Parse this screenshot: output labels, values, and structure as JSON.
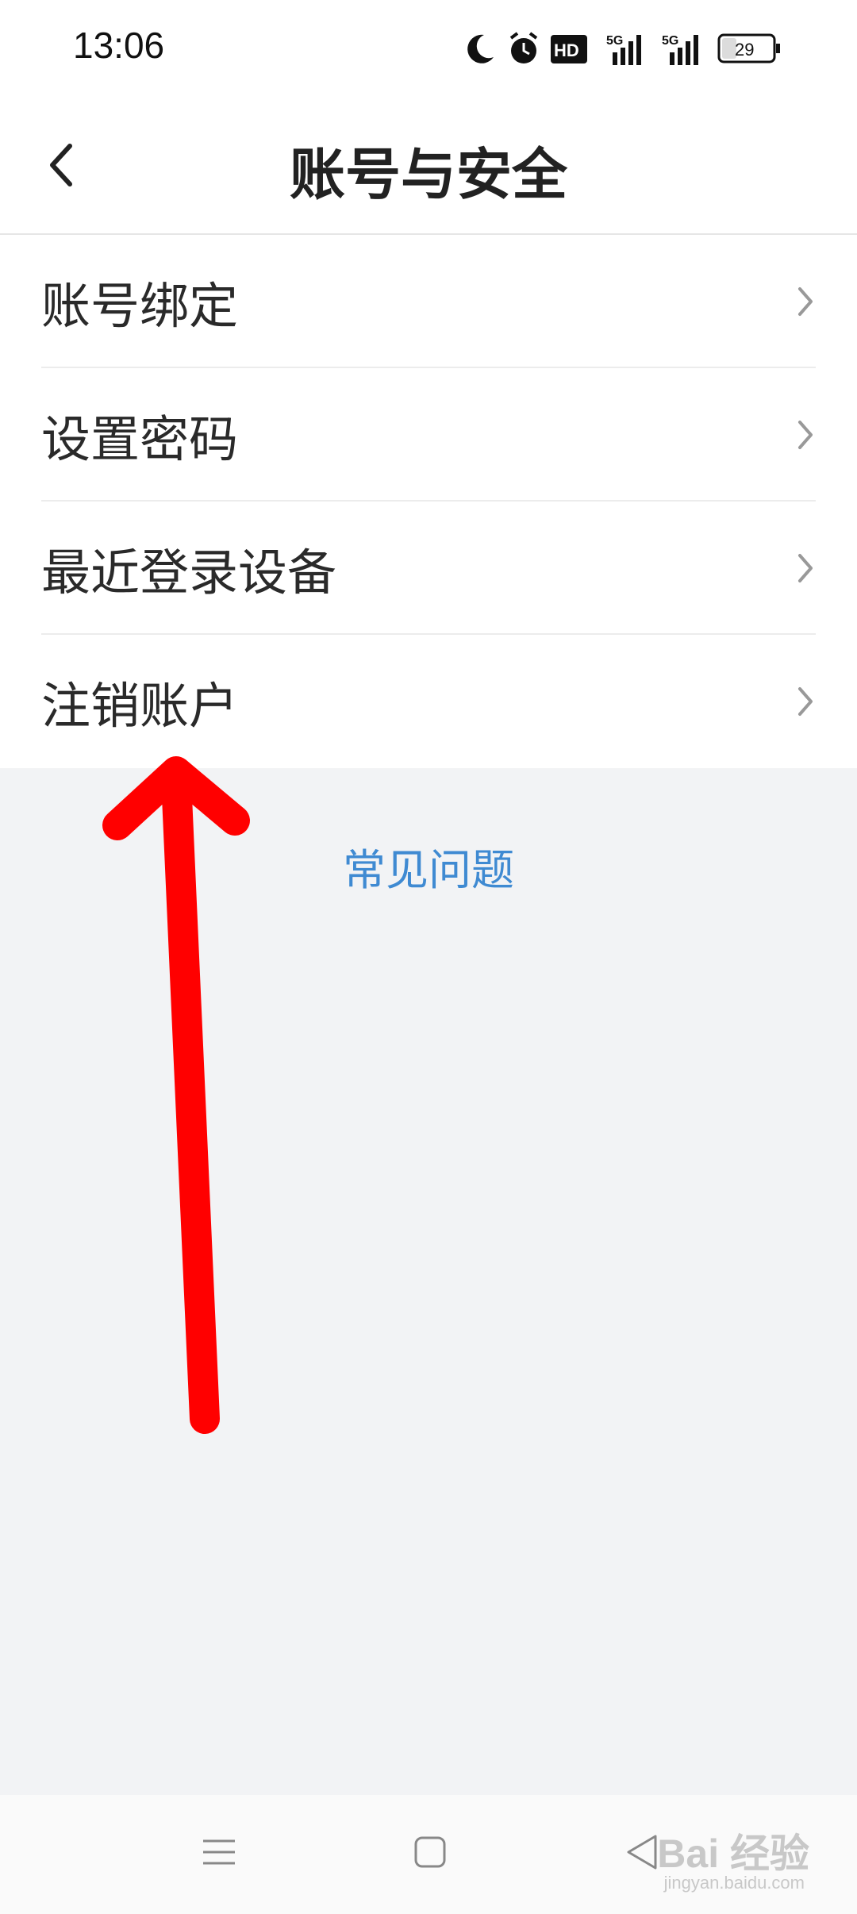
{
  "status_bar": {
    "time": "13:06",
    "hd_label": "HD",
    "signal_label_1": "5G",
    "signal_label_2": "5G",
    "battery_level": "29",
    "icons": [
      "moon-icon",
      "alarm-icon",
      "hd-icon",
      "signal-5g-icon",
      "signal-5g-icon",
      "battery-icon"
    ]
  },
  "header": {
    "title": "账号与安全",
    "back_icon": "back-arrow-icon"
  },
  "menu": {
    "items": [
      {
        "label": "账号绑定"
      },
      {
        "label": "设置密码"
      },
      {
        "label": "最近登录设备"
      },
      {
        "label": "注销账户"
      }
    ]
  },
  "faq": {
    "label": "常见问题"
  },
  "nav_bar": {
    "icons": [
      "menu-icon",
      "home-icon",
      "back-triangle-icon"
    ]
  },
  "watermark": {
    "text": "Bai 经验",
    "sub": "jingyan.baidu.com"
  },
  "colors": {
    "accent_link": "#3f8ad2",
    "annotation_arrow": "#ff0000",
    "page_bg": "#f2f3f5"
  }
}
